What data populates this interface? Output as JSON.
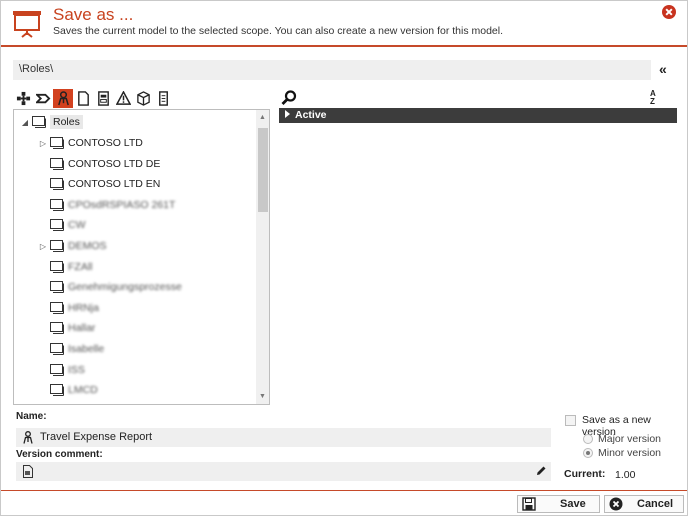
{
  "dialog": {
    "title": "Save as ...",
    "subtitle": "Saves the current model to the selected scope. You can also create a new version for this model."
  },
  "path": "\\Roles\\",
  "toolbar_icons": [
    "network-icon",
    "process-icon",
    "role-icon",
    "document-icon",
    "form-icon",
    "warning-icon",
    "cube-icon",
    "list-icon"
  ],
  "tree": {
    "root": "Roles",
    "items": [
      {
        "label": "CONTOSO LTD",
        "expandable": true,
        "blurred": false
      },
      {
        "label": "CONTOSO LTD DE",
        "expandable": false,
        "blurred": false
      },
      {
        "label": "CONTOSO LTD EN",
        "expandable": false,
        "blurred": false
      },
      {
        "label": "CPOsdRSPIASO 261T",
        "expandable": false,
        "blurred": true
      },
      {
        "label": "CW",
        "expandable": false,
        "blurred": true
      },
      {
        "label": "DEMOS",
        "expandable": true,
        "blurred": true
      },
      {
        "label": "FZAll",
        "expandable": false,
        "blurred": true
      },
      {
        "label": "Genehmigungsprozesse",
        "expandable": false,
        "blurred": true
      },
      {
        "label": "HRNja",
        "expandable": false,
        "blurred": true
      },
      {
        "label": "Hallar",
        "expandable": false,
        "blurred": true
      },
      {
        "label": "Isabelle",
        "expandable": false,
        "blurred": true
      },
      {
        "label": "ISS",
        "expandable": false,
        "blurred": true
      },
      {
        "label": "LMCD",
        "expandable": false,
        "blurred": true
      }
    ]
  },
  "right_panel": {
    "sort_label_top": "A",
    "sort_label_bottom": "Z",
    "active_label": "Active"
  },
  "form": {
    "name_label": "Name:",
    "name_value": "Travel Expense Report",
    "comment_label": "Version comment:",
    "comment_value": "",
    "save_new_version_label": "Save as a new version",
    "major_version_label": "Major version",
    "minor_version_label": "Minor version",
    "minor_selected": true,
    "current_label": "Current:",
    "current_value": "1.00"
  },
  "buttons": {
    "save": "Save",
    "cancel": "Cancel"
  },
  "colors": {
    "accent": "#c8431f",
    "active_bar": "#3c3c3c"
  }
}
